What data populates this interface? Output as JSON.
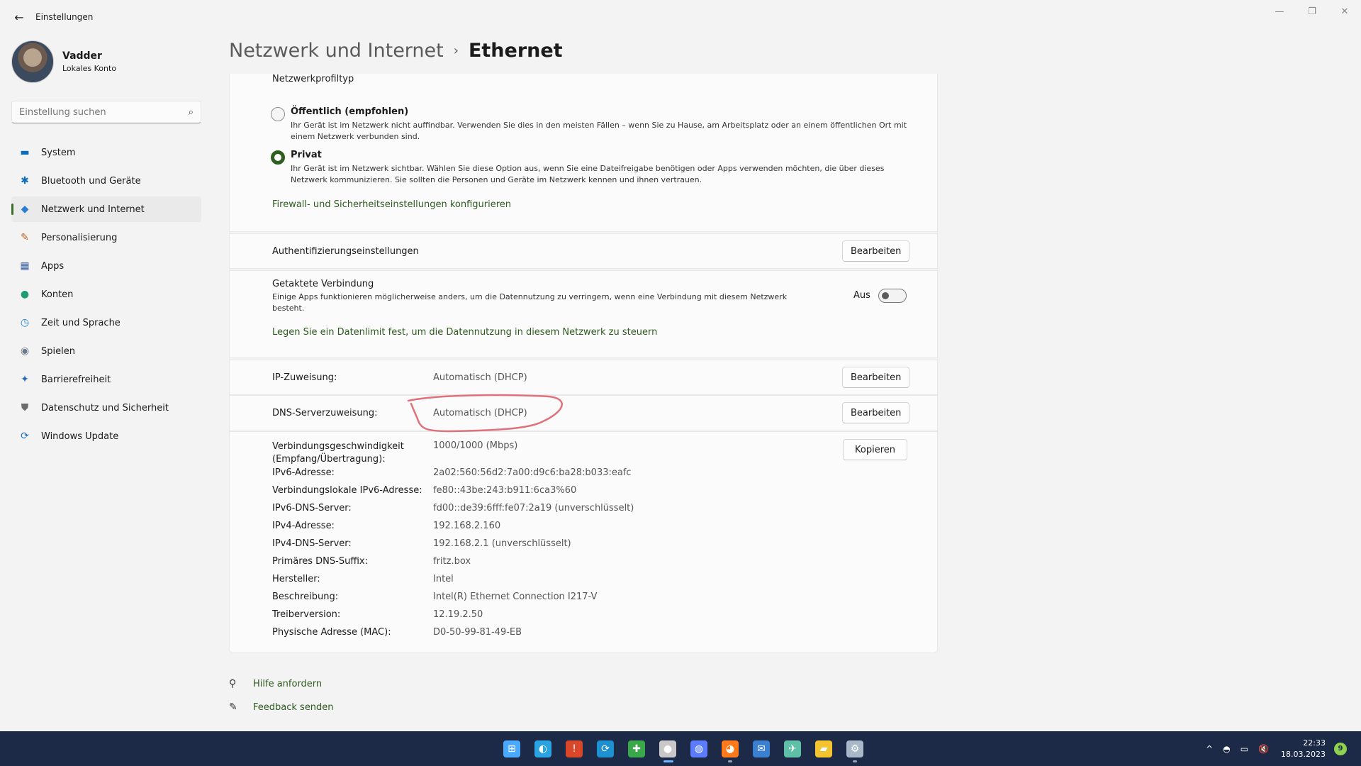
{
  "window": {
    "app_title": "Einstellungen",
    "back_icon": "←",
    "controls": [
      "—",
      "❐",
      "✕"
    ]
  },
  "profile": {
    "name": "Vadder",
    "account_type": "Lokales Konto"
  },
  "search": {
    "placeholder": "Einstellung suchen",
    "icon": "⌕"
  },
  "nav": {
    "items": [
      {
        "label": "System",
        "icon": "▬",
        "color": "#0a6cbd"
      },
      {
        "label": "Bluetooth und Geräte",
        "icon": "✱",
        "color": "#0a6cbd"
      },
      {
        "label": "Netzwerk und Internet",
        "icon": "◆",
        "color": "#2a7fd4"
      },
      {
        "label": "Personalisierung",
        "icon": "✎",
        "color": "#c2621a"
      },
      {
        "label": "Apps",
        "icon": "▦",
        "color": "#3a5fa0"
      },
      {
        "label": "Konten",
        "icon": "●",
        "color": "#1e9c76"
      },
      {
        "label": "Zeit und Sprache",
        "icon": "◷",
        "color": "#1e7fd0"
      },
      {
        "label": "Spielen",
        "icon": "◉",
        "color": "#6b7a8a"
      },
      {
        "label": "Barrierefreiheit",
        "icon": "✦",
        "color": "#1e6fc0"
      },
      {
        "label": "Datenschutz und Sicherheit",
        "icon": "⛊",
        "color": "#6b6b6b"
      },
      {
        "label": "Windows Update",
        "icon": "⟳",
        "color": "#1e6fc0"
      }
    ],
    "active_index": 2
  },
  "breadcrumb": {
    "parent": "Netzwerk und Internet",
    "separator": "›",
    "current": "Ethernet"
  },
  "profile_type": {
    "heading": "Netzwerkprofiltyp",
    "public_title": "Öffentlich (empfohlen)",
    "public_desc": "Ihr Gerät ist im Netzwerk nicht auffindbar. Verwenden Sie dies in den meisten Fällen – wenn Sie zu Hause, am Arbeitsplatz oder an einem öffentlichen Ort mit einem Netzwerk verbunden sind.",
    "private_title": "Privat",
    "private_desc": "Ihr Gerät ist im Netzwerk sichtbar. Wählen Sie diese Option aus, wenn Sie eine Dateifreigabe benötigen oder Apps verwenden möchten, die über dieses Netzwerk kommunizieren. Sie sollten die Personen und Geräte im Netzwerk kennen und ihnen vertrauen.",
    "selected": "private",
    "firewall_link": "Firewall- und Sicherheitseinstellungen konfigurieren"
  },
  "auth": {
    "label": "Authentifizierungseinstellungen",
    "button": "Bearbeiten"
  },
  "metered": {
    "label": "Getaktete Verbindung",
    "desc": "Einige Apps funktionieren möglicherweise anders, um die Datennutzung zu verringern, wenn eine Verbindung mit diesem Netzwerk besteht.",
    "state_label": "Aus",
    "data_limit_link": "Legen Sie ein Datenlimit fest, um die Datennutzung in diesem Netzwerk zu steuern"
  },
  "ip": {
    "label": "IP-Zuweisung:",
    "value": "Automatisch (DHCP)",
    "button": "Bearbeiten"
  },
  "dns": {
    "label": "DNS-Serverzuweisung:",
    "value": "Automatisch (DHCP)",
    "button": "Bearbeiten"
  },
  "properties": {
    "copy_button": "Kopieren",
    "speed_label_1": "Verbindungsgeschwindigkeit",
    "speed_label_2": "(Empfang/Übertragung):",
    "speed_value": "1000/1000 (Mbps)",
    "rows": [
      {
        "label": "IPv6-Adresse:",
        "value": "2a02:560:56d2:7a00:d9c6:ba28:b033:eafc"
      },
      {
        "label": "Verbindungslokale IPv6-Adresse:",
        "value": "fe80::43be:243:b911:6ca3%60"
      },
      {
        "label": "IPv6-DNS-Server:",
        "value": "fd00::de39:6fff:fe07:2a19 (unverschlüsselt)"
      },
      {
        "label": "IPv4-Adresse:",
        "value": "192.168.2.160"
      },
      {
        "label": "IPv4-DNS-Server:",
        "value": "192.168.2.1 (unverschlüsselt)"
      },
      {
        "label": "Primäres DNS-Suffix:",
        "value": "fritz.box"
      },
      {
        "label": "Hersteller:",
        "value": "Intel"
      },
      {
        "label": "Beschreibung:",
        "value": "Intel(R) Ethernet Connection I217-V"
      },
      {
        "label": "Treiberversion:",
        "value": "12.19.2.50"
      },
      {
        "label": "Physische Adresse (MAC):",
        "value": "D0-50-99-81-49-EB"
      }
    ]
  },
  "help": {
    "help_label": "Hilfe anfordern",
    "feedback_label": "Feedback senden"
  },
  "taskbar": {
    "apps": [
      {
        "name": "start",
        "glyph": "⊞",
        "color": "#4aa8ff",
        "running": false
      },
      {
        "name": "edge",
        "glyph": "◐",
        "color": "#2aa3e0",
        "running": false
      },
      {
        "name": "app-red",
        "glyph": "!",
        "color": "#d9472b",
        "running": false
      },
      {
        "name": "sync",
        "glyph": "⟳",
        "color": "#1e90d0",
        "running": false
      },
      {
        "name": "puzzle",
        "glyph": "✚",
        "color": "#3aa84a",
        "running": false
      },
      {
        "name": "app-bird",
        "glyph": "●",
        "color": "#c8c8c8",
        "running": true,
        "active": true
      },
      {
        "name": "chat",
        "glyph": "◍",
        "color": "#5b7cff",
        "running": false
      },
      {
        "name": "firefox",
        "glyph": "◕",
        "color": "#ff7a1a",
        "running": true
      },
      {
        "name": "thunderbird",
        "glyph": "✉",
        "color": "#3a7fd0",
        "running": false
      },
      {
        "name": "app-tools",
        "glyph": "✈",
        "color": "#5fc0a8",
        "running": false
      },
      {
        "name": "explorer",
        "glyph": "▰",
        "color": "#f4c430",
        "running": false
      },
      {
        "name": "settings",
        "glyph": "⚙",
        "color": "#a8b8c8",
        "running": true
      }
    ],
    "tray_icons": [
      "^",
      "◓",
      "▭",
      "🔇"
    ],
    "time": "22:33",
    "date": "18.03.2023",
    "notification_count": "9"
  }
}
